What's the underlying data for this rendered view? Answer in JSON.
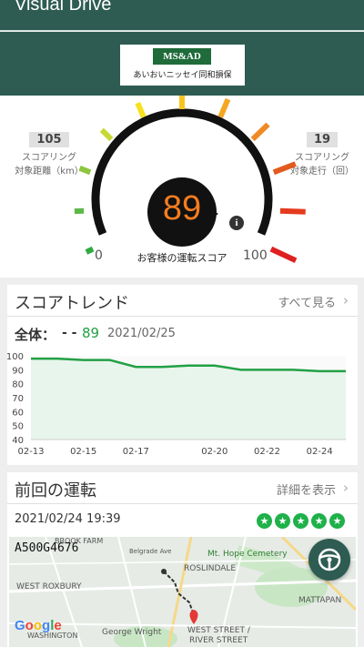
{
  "app": {
    "title": "Visual Drive"
  },
  "brand": {
    "logo_top": "MS&AD",
    "logo_sub": "あいおいニッセイ同和損保"
  },
  "score_card": {
    "distance_value": "105",
    "distance_label_1": "スコアリング",
    "distance_label_2": "対象距離（km）",
    "trips_value": "19",
    "trips_label_1": "スコアリング",
    "trips_label_2": "対象走行（回）",
    "score": "89",
    "min": "0",
    "max": "100",
    "label": "お客様の運転スコア",
    "info_glyph": "i"
  },
  "trend": {
    "title": "スコアトレンド",
    "see_all": "すべて見る",
    "chevron": "›",
    "overall_label": "全体：",
    "overall_dash": "- -",
    "overall_score": "89",
    "overall_date": "2021/02/25"
  },
  "chart_data": {
    "type": "area",
    "x": [
      "02-13",
      "02-14",
      "02-15",
      "02-16",
      "02-17",
      "02-18",
      "02-19",
      "02-20",
      "02-21",
      "02-22",
      "02-23",
      "02-24",
      "02-25"
    ],
    "values": [
      98,
      98,
      97,
      97,
      92,
      92,
      93,
      93,
      90,
      90,
      90,
      89,
      89
    ],
    "x_ticks": [
      "02-13",
      "02-15",
      "02-17",
      "02-20",
      "02-22",
      "02-24"
    ],
    "y_ticks": [
      100,
      90,
      80,
      70,
      60,
      50,
      40
    ],
    "ylim": [
      40,
      100
    ],
    "grid": false,
    "color": "#22a045"
  },
  "last_drive": {
    "title": "前回の運転",
    "details": "詳細を表示",
    "chevron": "›",
    "datetime": "2021/02/24 19:39",
    "stars": 5,
    "star_glyph": "★",
    "vehicle_id": "A500G4676"
  },
  "map": {
    "google": [
      "G",
      "o",
      "o",
      "g",
      "l",
      "e"
    ],
    "labels": {
      "brook_farm": "BROOK FARM",
      "belgrade": "Belgrade Ave",
      "mt_hope": "Mt. Hope Cemetery",
      "roslindale": "ROSLINDALE",
      "west_roxbury": "WEST ROXBURY",
      "mattapan": "MATTAPAN",
      "george_wright": "George Wright",
      "west_street": "WEST STREET /",
      "river_street": "RIVER STREET",
      "washington": "WASHINGTON"
    }
  },
  "colors": {
    "header": "#2e5c52",
    "accent_green": "#22a045",
    "score_orange": "#f57c1f",
    "star_green": "#1fb14a"
  },
  "icons": {
    "fab": "steering-wheel-icon",
    "info": "info-icon",
    "pin": "map-pin-icon"
  }
}
